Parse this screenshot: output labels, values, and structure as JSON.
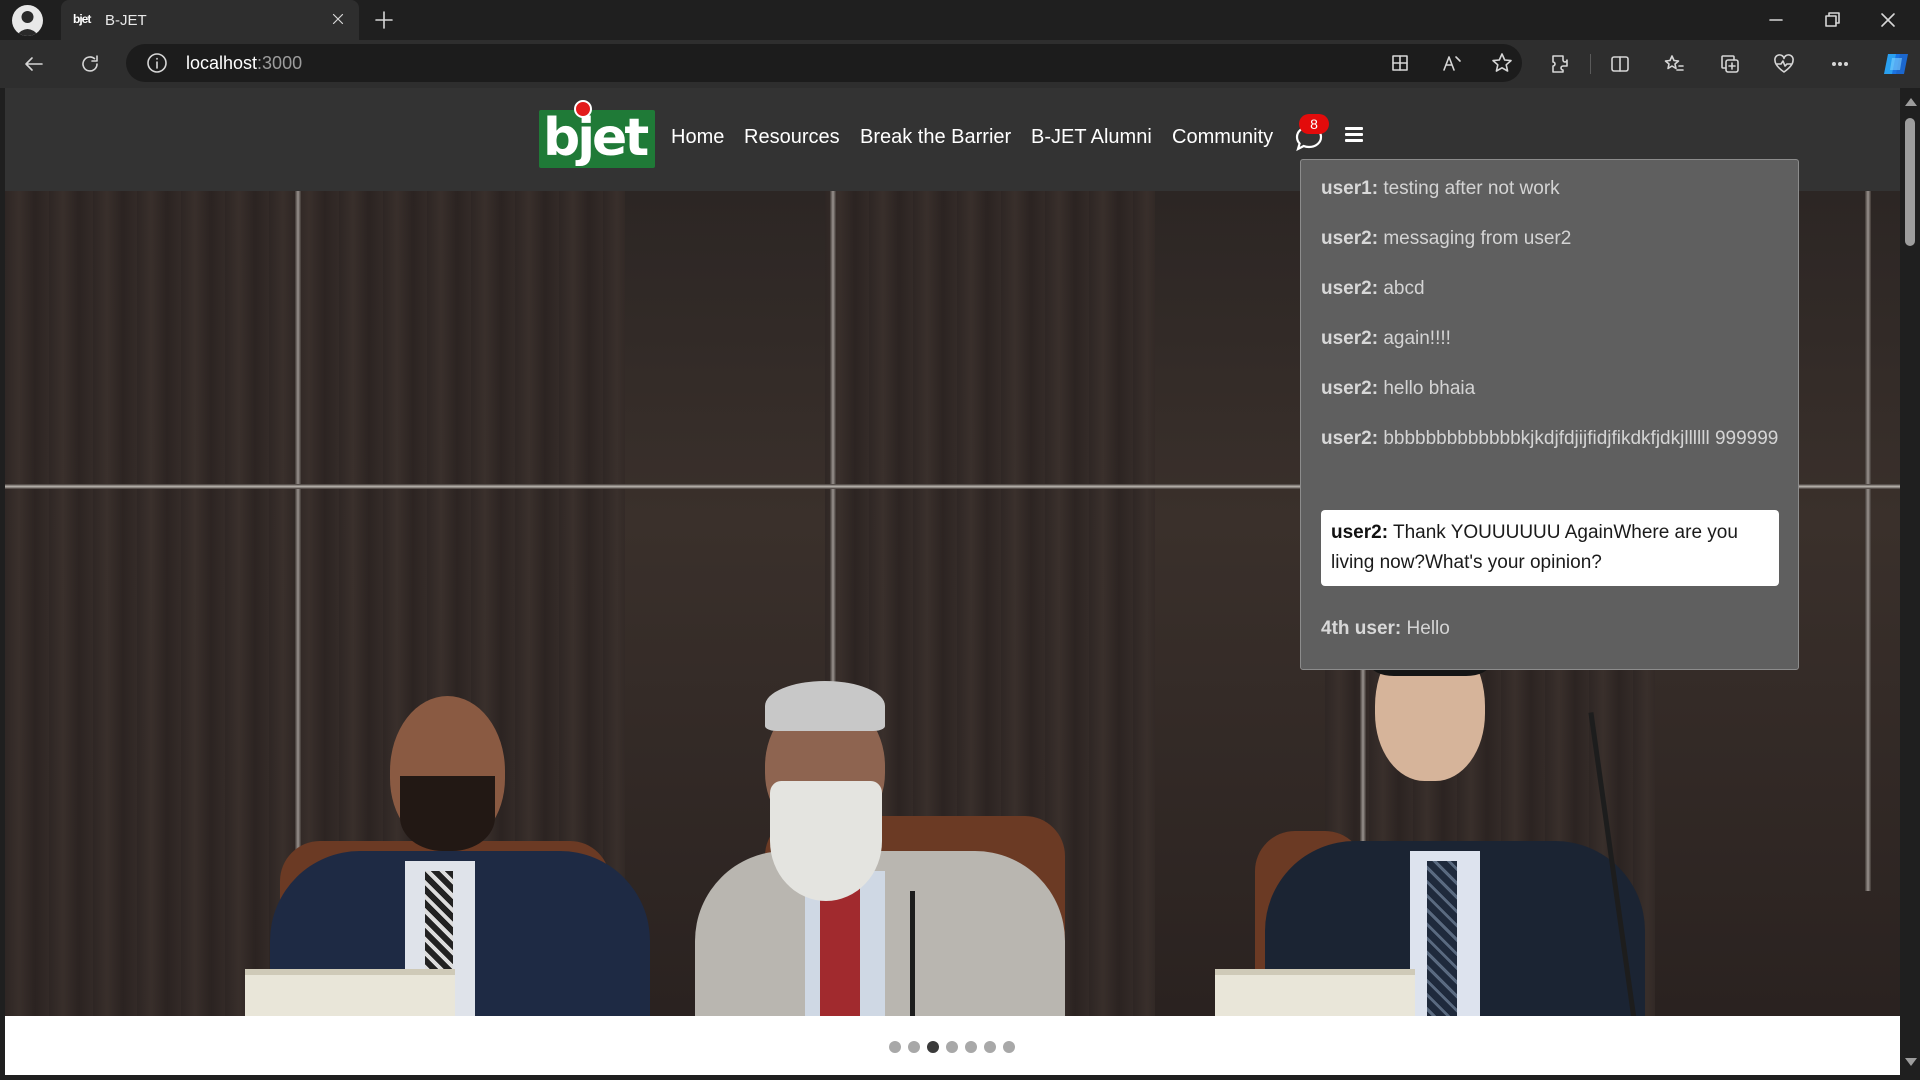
{
  "browser": {
    "tab": {
      "favicon_text": "bjet",
      "title": "B-JET"
    },
    "address": {
      "host": "localhost",
      "port": ":3000"
    },
    "colors": {
      "chrome": "#1f1f1f",
      "toolbar": "#2e2e2e"
    }
  },
  "site": {
    "logo_text": "bjet",
    "nav": [
      {
        "label": "Home"
      },
      {
        "label": "Resources"
      },
      {
        "label": "Break the Barrier"
      },
      {
        "label": "B-JET Alumni"
      },
      {
        "label": "Community"
      }
    ],
    "chat": {
      "badge_count": "8"
    },
    "colors": {
      "header": "#333333",
      "logo_green": "#1f7a37",
      "badge_red": "#e30b0b"
    }
  },
  "chat_panel": {
    "messages": [
      {
        "user": "user1:",
        "text": "testing after not work"
      },
      {
        "user": "user2:",
        "text": "messaging from user2"
      },
      {
        "user": "user2:",
        "text": "abcd"
      },
      {
        "user": "user2:",
        "text": "again!!!!"
      },
      {
        "user": "user2:",
        "text": "hello bhaia"
      },
      {
        "user": "user2:",
        "text": "bbbbbbbbbbbbbkjkdjfdjijfidjfikdkfjdkjllllll 999999"
      },
      {
        "user": "user2:",
        "text": "Thank YOUUUUUU AgainWhere are you living now?What's your opinion?",
        "highlighted": true
      },
      {
        "user": "4th user:",
        "text": "Hello"
      }
    ]
  },
  "carousel": {
    "slide_count": 7,
    "active_index": 2
  }
}
